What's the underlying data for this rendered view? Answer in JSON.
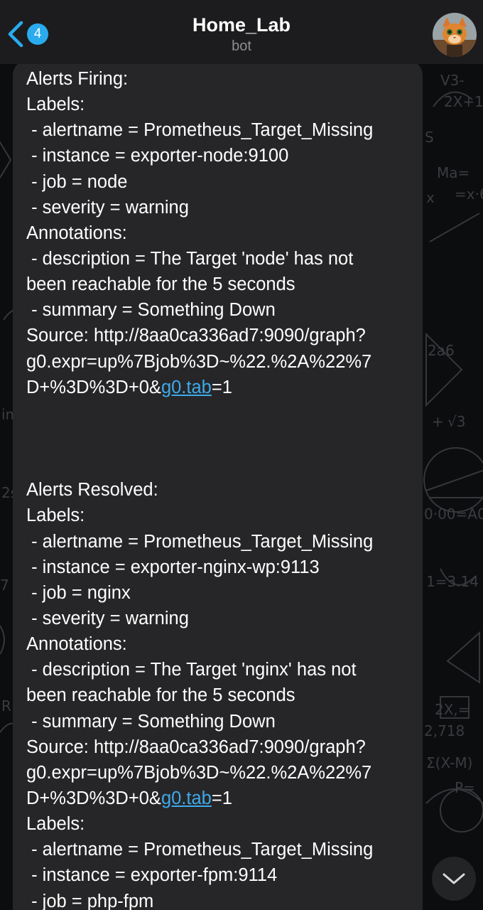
{
  "header": {
    "back_badge": "4",
    "title": "Home_Lab",
    "subtitle": "bot",
    "avatar_icon": "cat-avatar-icon"
  },
  "colors": {
    "accent": "#2aabee",
    "link": "#3fa9ea",
    "bubble": "#262628",
    "header_bg": "#1c1c1e",
    "background": "#0c0d0f"
  },
  "message": {
    "firing": {
      "heading": "Alerts Firing:",
      "labels_heading": "Labels:",
      "labels": [
        " - alertname = Prometheus_Target_Missing",
        " - instance = exporter-node:9100",
        " - job = node",
        " - severity = warning"
      ],
      "annotations_heading": "Annotations:",
      "description_line1": " - description = The Target 'node' has not",
      "description_line2": "been reachable for the 5 seconds",
      "summary": " - summary = Something Down",
      "source_line1": "Source: http://8aa0ca336ad7:9090/graph?",
      "source_line2": "g0.expr=up%7Bjob%3D~%22.%2A%22%7",
      "source_line3_prefix": "D+%3D%3D+0&",
      "source_link": "g0.tab",
      "source_line3_suffix": "=1"
    },
    "resolved": {
      "heading": "Alerts Resolved:",
      "labels_heading": "Labels:",
      "labels": [
        " - alertname = Prometheus_Target_Missing",
        " - instance = exporter-nginx-wp:9113",
        " - job = nginx",
        " - severity = warning"
      ],
      "annotations_heading": "Annotations:",
      "description_line1": " - description = The Target 'nginx' has not",
      "description_line2": "been reachable for the 5 seconds",
      "summary": " - summary = Something Down",
      "source_line1": "Source: http://8aa0ca336ad7:9090/graph?",
      "source_line2": "g0.expr=up%7Bjob%3D~%22.%2A%22%7",
      "source_line3_prefix": "D+%3D%3D+0&",
      "source_link": "g0.tab",
      "source_line3_suffix": "=1",
      "labels2_heading": "Labels:",
      "labels2": [
        " - alertname = Prometheus_Target_Missing",
        " - instance = exporter-fpm:9114",
        " - job = php-fpm"
      ]
    }
  },
  "scroll_button_icon": "chevron-down-icon"
}
